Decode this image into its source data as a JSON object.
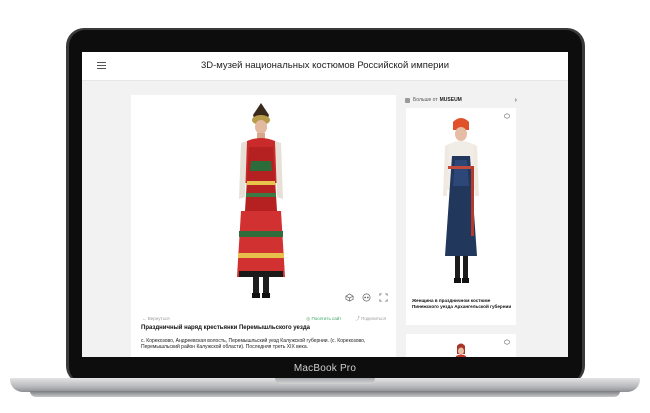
{
  "app": {
    "title": "3D-музей национальных костюмов Российской империи"
  },
  "main_item": {
    "back_label": "Вернуться",
    "action_view": "Посетить сайт",
    "action_share": "Поделиться",
    "title": "Праздничный наряд крестьянки Перемышльского уезда",
    "description": "с. Корекозово, Андреевская волость, Перемышльский уезд Калужской губернии. (с. Корекозово, Перемышльский район Калужской области). Последняя треть XIX века."
  },
  "sidebar": {
    "more_from_label": "Больше от",
    "brand": "MUSEUM",
    "items": [
      {
        "caption": "Женщина в праздничном костюме Пинежского уезда Архангельской губернии"
      }
    ]
  },
  "device": {
    "label": "MacBook Pro"
  },
  "colors": {
    "accent_green": "#3fa76a",
    "screen_bg": "#f2f2f2"
  }
}
